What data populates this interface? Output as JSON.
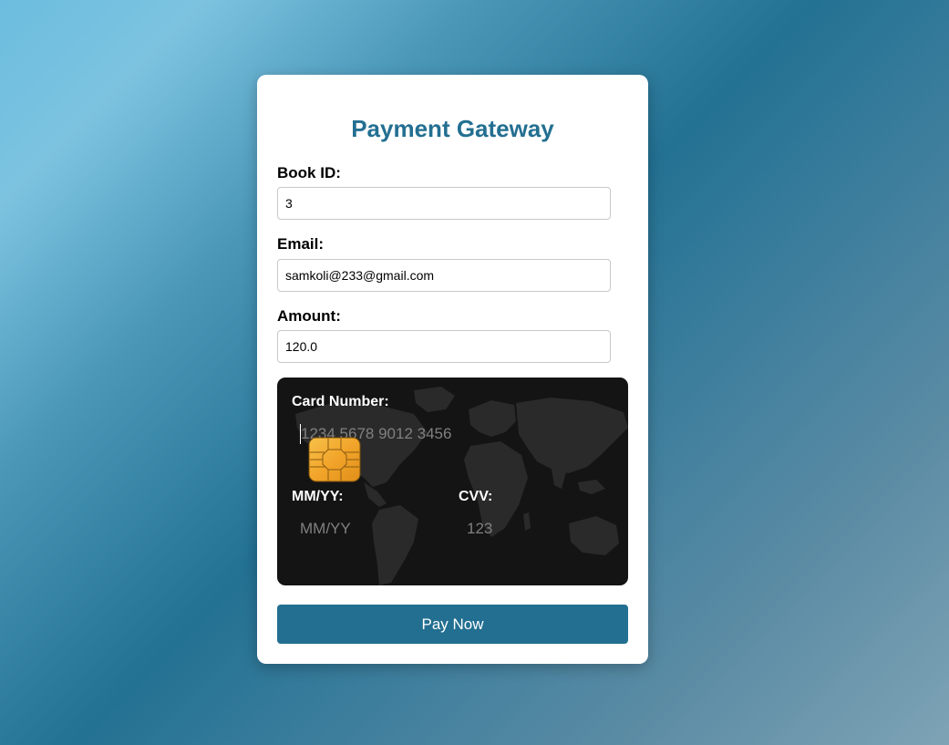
{
  "form": {
    "title": "Payment Gateway",
    "book_id": {
      "label": "Book ID:",
      "value": "3"
    },
    "email": {
      "label": "Email:",
      "value": "samkoli@233@gmail.com"
    },
    "amount": {
      "label": "Amount:",
      "value": "120.0"
    }
  },
  "card": {
    "number": {
      "label": "Card Number:",
      "placeholder": "1234 5678 9012 3456",
      "value": ""
    },
    "expiry": {
      "label": "MM/YY:",
      "placeholder": "MM/YY",
      "value": ""
    },
    "cvv": {
      "label": "CVV:",
      "placeholder": "123",
      "value": ""
    },
    "chip_icon": "card-chip-icon",
    "background_icon": "world-map-icon"
  },
  "actions": {
    "pay_label": "Pay Now"
  },
  "colors": {
    "accent": "#236f91",
    "card_background": "#141414",
    "panel_background": "#ffffff"
  }
}
